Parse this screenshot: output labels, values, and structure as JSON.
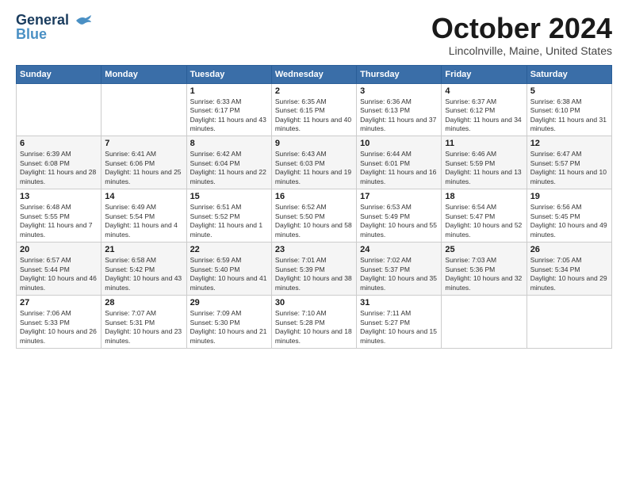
{
  "logo": {
    "line1": "General",
    "line2": "Blue"
  },
  "title": "October 2024",
  "location": "Lincolnville, Maine, United States",
  "weekdays": [
    "Sunday",
    "Monday",
    "Tuesday",
    "Wednesday",
    "Thursday",
    "Friday",
    "Saturday"
  ],
  "weeks": [
    [
      {
        "day": "",
        "info": ""
      },
      {
        "day": "",
        "info": ""
      },
      {
        "day": "1",
        "info": "Sunrise: 6:33 AM\nSunset: 6:17 PM\nDaylight: 11 hours and 43 minutes."
      },
      {
        "day": "2",
        "info": "Sunrise: 6:35 AM\nSunset: 6:15 PM\nDaylight: 11 hours and 40 minutes."
      },
      {
        "day": "3",
        "info": "Sunrise: 6:36 AM\nSunset: 6:13 PM\nDaylight: 11 hours and 37 minutes."
      },
      {
        "day": "4",
        "info": "Sunrise: 6:37 AM\nSunset: 6:12 PM\nDaylight: 11 hours and 34 minutes."
      },
      {
        "day": "5",
        "info": "Sunrise: 6:38 AM\nSunset: 6:10 PM\nDaylight: 11 hours and 31 minutes."
      }
    ],
    [
      {
        "day": "6",
        "info": "Sunrise: 6:39 AM\nSunset: 6:08 PM\nDaylight: 11 hours and 28 minutes."
      },
      {
        "day": "7",
        "info": "Sunrise: 6:41 AM\nSunset: 6:06 PM\nDaylight: 11 hours and 25 minutes."
      },
      {
        "day": "8",
        "info": "Sunrise: 6:42 AM\nSunset: 6:04 PM\nDaylight: 11 hours and 22 minutes."
      },
      {
        "day": "9",
        "info": "Sunrise: 6:43 AM\nSunset: 6:03 PM\nDaylight: 11 hours and 19 minutes."
      },
      {
        "day": "10",
        "info": "Sunrise: 6:44 AM\nSunset: 6:01 PM\nDaylight: 11 hours and 16 minutes."
      },
      {
        "day": "11",
        "info": "Sunrise: 6:46 AM\nSunset: 5:59 PM\nDaylight: 11 hours and 13 minutes."
      },
      {
        "day": "12",
        "info": "Sunrise: 6:47 AM\nSunset: 5:57 PM\nDaylight: 11 hours and 10 minutes."
      }
    ],
    [
      {
        "day": "13",
        "info": "Sunrise: 6:48 AM\nSunset: 5:55 PM\nDaylight: 11 hours and 7 minutes."
      },
      {
        "day": "14",
        "info": "Sunrise: 6:49 AM\nSunset: 5:54 PM\nDaylight: 11 hours and 4 minutes."
      },
      {
        "day": "15",
        "info": "Sunrise: 6:51 AM\nSunset: 5:52 PM\nDaylight: 11 hours and 1 minute."
      },
      {
        "day": "16",
        "info": "Sunrise: 6:52 AM\nSunset: 5:50 PM\nDaylight: 10 hours and 58 minutes."
      },
      {
        "day": "17",
        "info": "Sunrise: 6:53 AM\nSunset: 5:49 PM\nDaylight: 10 hours and 55 minutes."
      },
      {
        "day": "18",
        "info": "Sunrise: 6:54 AM\nSunset: 5:47 PM\nDaylight: 10 hours and 52 minutes."
      },
      {
        "day": "19",
        "info": "Sunrise: 6:56 AM\nSunset: 5:45 PM\nDaylight: 10 hours and 49 minutes."
      }
    ],
    [
      {
        "day": "20",
        "info": "Sunrise: 6:57 AM\nSunset: 5:44 PM\nDaylight: 10 hours and 46 minutes."
      },
      {
        "day": "21",
        "info": "Sunrise: 6:58 AM\nSunset: 5:42 PM\nDaylight: 10 hours and 43 minutes."
      },
      {
        "day": "22",
        "info": "Sunrise: 6:59 AM\nSunset: 5:40 PM\nDaylight: 10 hours and 41 minutes."
      },
      {
        "day": "23",
        "info": "Sunrise: 7:01 AM\nSunset: 5:39 PM\nDaylight: 10 hours and 38 minutes."
      },
      {
        "day": "24",
        "info": "Sunrise: 7:02 AM\nSunset: 5:37 PM\nDaylight: 10 hours and 35 minutes."
      },
      {
        "day": "25",
        "info": "Sunrise: 7:03 AM\nSunset: 5:36 PM\nDaylight: 10 hours and 32 minutes."
      },
      {
        "day": "26",
        "info": "Sunrise: 7:05 AM\nSunset: 5:34 PM\nDaylight: 10 hours and 29 minutes."
      }
    ],
    [
      {
        "day": "27",
        "info": "Sunrise: 7:06 AM\nSunset: 5:33 PM\nDaylight: 10 hours and 26 minutes."
      },
      {
        "day": "28",
        "info": "Sunrise: 7:07 AM\nSunset: 5:31 PM\nDaylight: 10 hours and 23 minutes."
      },
      {
        "day": "29",
        "info": "Sunrise: 7:09 AM\nSunset: 5:30 PM\nDaylight: 10 hours and 21 minutes."
      },
      {
        "day": "30",
        "info": "Sunrise: 7:10 AM\nSunset: 5:28 PM\nDaylight: 10 hours and 18 minutes."
      },
      {
        "day": "31",
        "info": "Sunrise: 7:11 AM\nSunset: 5:27 PM\nDaylight: 10 hours and 15 minutes."
      },
      {
        "day": "",
        "info": ""
      },
      {
        "day": "",
        "info": ""
      }
    ]
  ]
}
